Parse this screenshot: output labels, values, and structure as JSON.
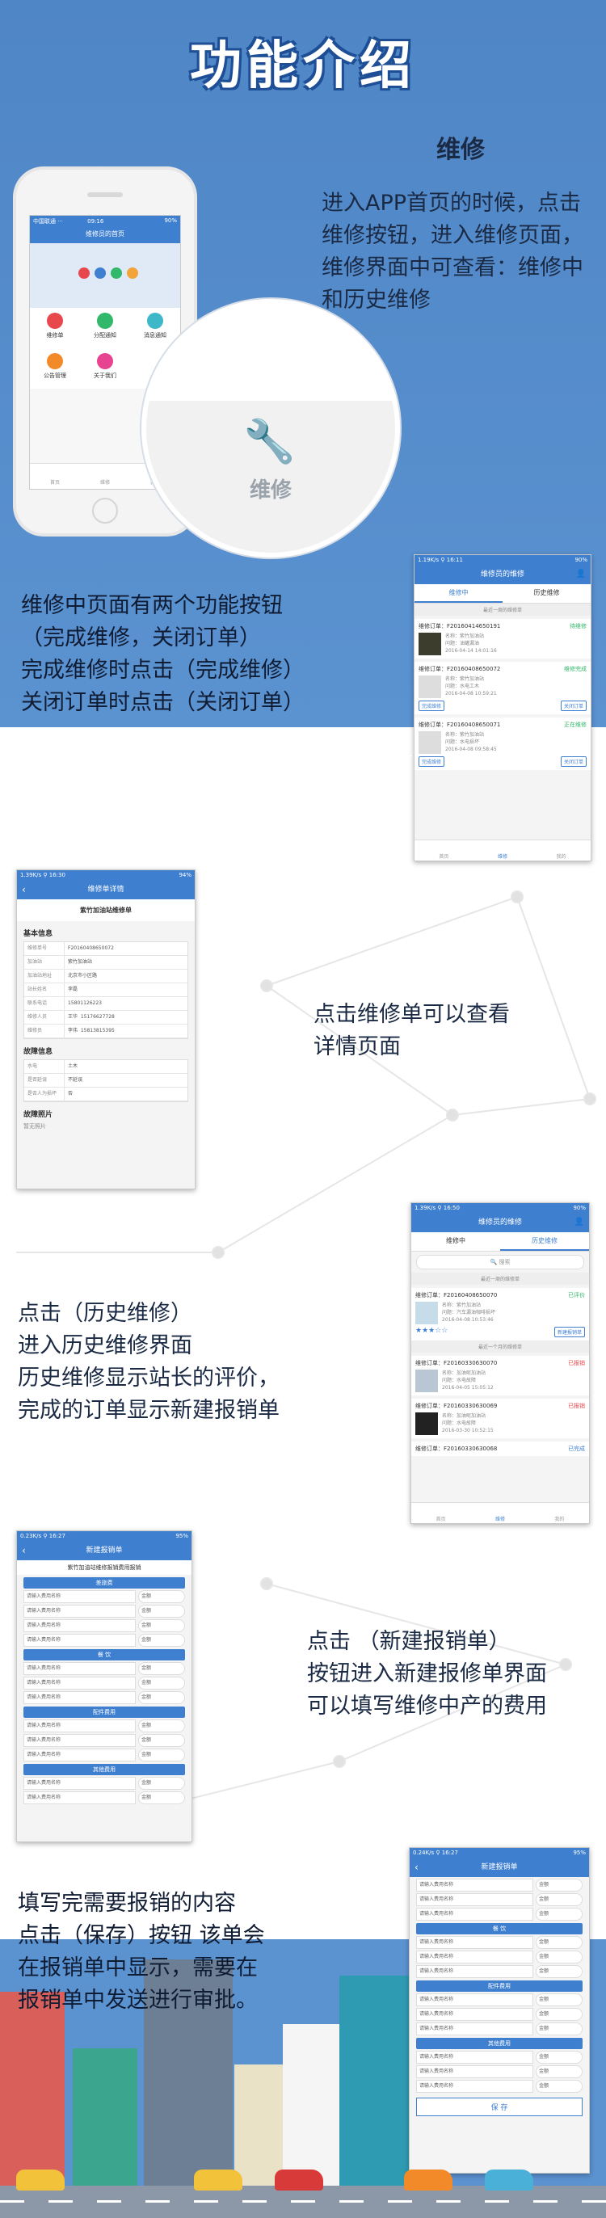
{
  "title": "功能介绍",
  "section": "维修",
  "desc1": [
    "进入APP首页的时候，点击",
    "维修按钮，进入维修页面，",
    "维修界面中可查看：维修中",
    "和历史维修"
  ],
  "desc2": [
    "维修中页面有两个功能按钮",
    "（完成维修，关闭订单）",
    "完成维修时点击（完成维修）",
    "关闭订单时点击（关闭订单）"
  ],
  "desc3": [
    "点击维修单可以查看",
    "详情页面"
  ],
  "desc4": [
    "点击（历史维修）",
    "进入历史维修界面",
    "历史维修显示站长的评价，",
    "完成的订单显示新建报销单"
  ],
  "desc5": [
    "点击 （新建报销单）",
    "按钮进入新建报修单界面",
    "可以填写维修中产的费用"
  ],
  "desc6": [
    "填写完需要报销的内容",
    "点击（保存）按钮 该单会",
    "在报销单中显示，需要在",
    "报销单中发送进行审批。"
  ],
  "home": {
    "status": "中国联通 ···",
    "time": "09:16",
    "battery": "90%",
    "nav": "维修员的首页",
    "grid": [
      "维修单",
      "分配通知",
      "消息通知",
      "公告管理",
      "关于我们"
    ],
    "tabs": [
      "首页",
      "维修",
      "我的"
    ]
  },
  "zoom_label": "维修",
  "s1": {
    "status": "1.19K/s ⚲ 16:11",
    "battery": "90%",
    "nav": "维修员的维修",
    "tabs": [
      "维修中",
      "历史维修"
    ],
    "divider": "最近一周的维修单",
    "orders": [
      {
        "no": "维修订单：F20160414650191",
        "state": "待维修",
        "name": "名称：紫竹加油站",
        "issue": "问题：油罐漏油",
        "date": "2016-04-14 14:01:16"
      },
      {
        "no": "维修订单：F20160408650072",
        "state": "维修完成",
        "name": "名称：紫竹加油站",
        "issue": "问题：水电工木",
        "date": "2016-04-08 10:59:21"
      },
      {
        "no": "维修订单：F20160408650071",
        "state": "正在维修",
        "name": "名称：紫竹加油站",
        "issue": "问题：水电损坏",
        "date": "2016-04-08 09:58:45"
      }
    ],
    "btn_done": "完成维修",
    "btn_close": "关闭订单",
    "tabbar": [
      "首页",
      "维修",
      "我的"
    ]
  },
  "s2": {
    "status": "1.39K/s ⚲ 16:30",
    "battery": "94%",
    "nav": "维修单详情",
    "head": "紫竹加油站维修单",
    "sec1": "基本信息",
    "rows": [
      [
        "维修单号",
        "F20160408650072"
      ],
      [
        "加油站",
        "紫竹加油站"
      ],
      [
        "加油站地址",
        "北京市小区路"
      ],
      [
        "站长姓名",
        "李磊"
      ],
      [
        "联系电话",
        "15801126223"
      ],
      [
        "维修人员",
        "王华",
        "15176627728"
      ],
      [
        "维修员",
        "李伟",
        "15813815395"
      ]
    ],
    "sec2": "故障信息",
    "rows2": [
      [
        "水电",
        "土木"
      ],
      [
        "是否延误",
        "不延误"
      ],
      [
        "是否人为损坏",
        "否"
      ]
    ],
    "sec3": "故障照片",
    "noimg": "暂无照片"
  },
  "s3": {
    "status": "1.39K/s ⚲ 16:50",
    "battery": "90%",
    "nav": "维修员的维修",
    "tabs": [
      "维修中",
      "历史维修"
    ],
    "search": "搜索",
    "div1": "最近一周的维修单",
    "div2": "最近一个月的维修单",
    "orders": [
      {
        "no": "维修订单：F20160408650070",
        "state": "已评价",
        "name": "名称：紫竹加油站",
        "issue": "问题：汽车漏油咖啡损坏",
        "date": "2016-04-08 10:53:46",
        "btn": "新建报销单"
      },
      {
        "no": "维修订单：F20160330630070",
        "state": "已报销",
        "name": "名称：加油呢加油站",
        "issue": "问题：水电故障",
        "date": "2016-04-05 15:05:12"
      },
      {
        "no": "维修订单：F20160330630069",
        "state": "已报销",
        "name": "名称：加油呢加油站",
        "issue": "问题：水电故障",
        "date": "2016-03-30 10:52:15"
      },
      {
        "no": "维修订单：F20160330630068",
        "state": "已完成",
        "name": "",
        "issue": "",
        "date": ""
      }
    ],
    "tabbar": [
      "首页",
      "维修",
      "我的"
    ]
  },
  "s4": {
    "status": "0.23K/s ⚲ 16:27",
    "battery": "95%",
    "nav": "新建报销单",
    "head": "紫竹加油站维修报销费用报销",
    "field": "请输入费用名称",
    "amount": "金额",
    "sections": [
      "差旅费",
      "餐 饮",
      "配件费用",
      "其他费用"
    ]
  },
  "s5": {
    "status": "0.24K/s ⚲ 16:27",
    "battery": "95%",
    "nav": "新建报销单",
    "field": "请输入费用名称",
    "amount": "金额",
    "sections": [
      "餐 饮",
      "配件费用",
      "其他费用"
    ],
    "save": "保 存"
  },
  "colors": {
    "sky": "#5b92d0",
    "accent": "#3e7fd0"
  }
}
